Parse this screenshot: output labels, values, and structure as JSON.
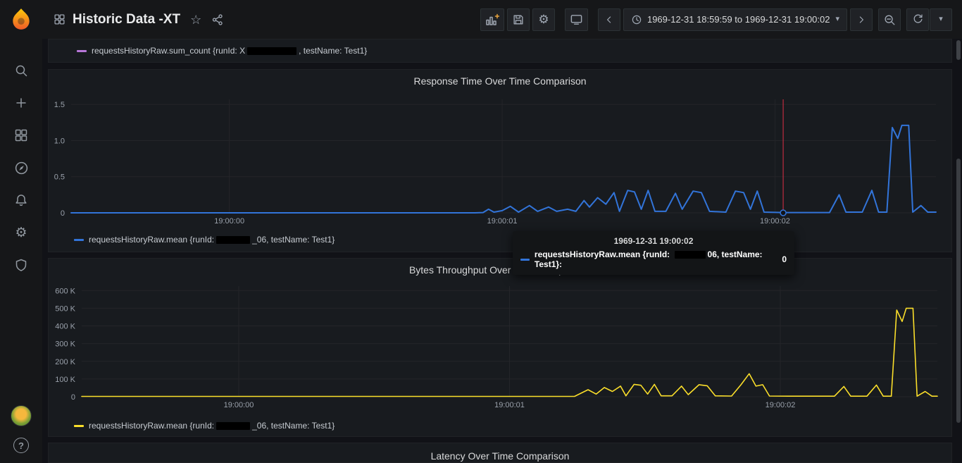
{
  "colors": {
    "blue": "#3274d9",
    "yellow": "#fade2a",
    "purple": "#b877d9",
    "red": "#e02f44"
  },
  "icons": {
    "star": "☆",
    "gear": "⚙",
    "caret_down": "▾",
    "help": "?"
  },
  "nav": {
    "title": "Historic Data -XT",
    "time_range": "1969-12-31 18:59:59 to 1969-12-31 19:00:02"
  },
  "top_panel": {
    "legend_color": "#b877d9",
    "legend_pre": "requestsHistoryRaw.sum_count {runId: X",
    "legend_post": ", testName: Test1}"
  },
  "tooltip": {
    "timestamp": "1969-12-31 19:00:02",
    "series_color": "#3274d9",
    "label_pre": "requestsHistoryRaw.mean {runId: ",
    "label_post": "06, testName: Test1}:",
    "value": "0"
  },
  "latency_panel": {
    "title": "Latency Over Time Comparison"
  },
  "chart_data": [
    {
      "type": "line",
      "title": "Response Time Over Time Comparison",
      "series_label_pre": "requestsHistoryRaw.mean {runId: ",
      "series_label_post": "_06, testName: Test1}",
      "color": "#3274d9",
      "line_width": 2,
      "x_ticks": [
        {
          "value": 0,
          "label": "19:00:00"
        },
        {
          "value": 1,
          "label": "19:00:01"
        },
        {
          "value": 2,
          "label": "19:00:02"
        }
      ],
      "y_ticks": [
        {
          "value": 0,
          "label": "0"
        },
        {
          "value": 0.5,
          "label": "0.5"
        },
        {
          "value": 1.0,
          "label": "1.0"
        },
        {
          "value": 1.5,
          "label": "1.5"
        }
      ],
      "x_range": [
        -0.58,
        2.59
      ],
      "y_range": [
        0,
        1.57
      ],
      "annotation_x": 2.03,
      "annotation_color": "#e02f44",
      "hover_point": [
        2.03,
        0
      ],
      "points": [
        [
          -0.58,
          0
        ],
        [
          0.3,
          0
        ],
        [
          0.6,
          0
        ],
        [
          0.9,
          0
        ],
        [
          0.93,
          0.004
        ],
        [
          0.95,
          0.05
        ],
        [
          0.97,
          0.01
        ],
        [
          1.0,
          0.03
        ],
        [
          1.03,
          0.09
        ],
        [
          1.06,
          0.01
        ],
        [
          1.1,
          0.1
        ],
        [
          1.13,
          0.02
        ],
        [
          1.17,
          0.08
        ],
        [
          1.2,
          0.02
        ],
        [
          1.24,
          0.05
        ],
        [
          1.27,
          0.02
        ],
        [
          1.3,
          0.17
        ],
        [
          1.32,
          0.08
        ],
        [
          1.35,
          0.21
        ],
        [
          1.38,
          0.12
        ],
        [
          1.41,
          0.28
        ],
        [
          1.43,
          0.02
        ],
        [
          1.46,
          0.31
        ],
        [
          1.485,
          0.29
        ],
        [
          1.51,
          0.05
        ],
        [
          1.535,
          0.31
        ],
        [
          1.56,
          0.02
        ],
        [
          1.6,
          0.02
        ],
        [
          1.635,
          0.27
        ],
        [
          1.66,
          0.05
        ],
        [
          1.7,
          0.3
        ],
        [
          1.73,
          0.28
        ],
        [
          1.76,
          0.02
        ],
        [
          1.82,
          0.01
        ],
        [
          1.855,
          0.3
        ],
        [
          1.885,
          0.28
        ],
        [
          1.91,
          0.05
        ],
        [
          1.935,
          0.3
        ],
        [
          1.96,
          0.01
        ],
        [
          2.03,
          0.004
        ],
        [
          2.12,
          0.004
        ],
        [
          2.2,
          0.004
        ],
        [
          2.235,
          0.25
        ],
        [
          2.26,
          0.01
        ],
        [
          2.32,
          0.01
        ],
        [
          2.355,
          0.31
        ],
        [
          2.38,
          0.01
        ],
        [
          2.41,
          0.01
        ],
        [
          2.43,
          1.18
        ],
        [
          2.45,
          1.03
        ],
        [
          2.465,
          1.21
        ],
        [
          2.49,
          1.21
        ],
        [
          2.505,
          0.01
        ],
        [
          2.535,
          0.1
        ],
        [
          2.56,
          0.01
        ],
        [
          2.59,
          0.01
        ]
      ]
    },
    {
      "type": "line",
      "title": "Bytes Throughput Over Time Comparison",
      "series_label_pre": "requestsHistoryRaw.mean {runId: ",
      "series_label_post": "_06, testName: Test1}",
      "color": "#fade2a",
      "line_width": 1.6,
      "x_ticks": [
        {
          "value": 0,
          "label": "19:00:00"
        },
        {
          "value": 1,
          "label": "19:00:01"
        },
        {
          "value": 2,
          "label": "19:00:02"
        }
      ],
      "y_ticks": [
        {
          "value": 0,
          "label": "0"
        },
        {
          "value": 100000,
          "label": "100 K"
        },
        {
          "value": 200000,
          "label": "200 K"
        },
        {
          "value": 300000,
          "label": "300 K"
        },
        {
          "value": 400000,
          "label": "400 K"
        },
        {
          "value": 500000,
          "label": "500 K"
        },
        {
          "value": 600000,
          "label": "600 K"
        }
      ],
      "x_range": [
        -0.58,
        2.58
      ],
      "y_range": [
        0,
        625000
      ],
      "annotation_x": null,
      "annotation_color": null,
      "hover_point": null,
      "points": [
        [
          -0.58,
          2000
        ],
        [
          0.5,
          2000
        ],
        [
          1.0,
          2000
        ],
        [
          1.24,
          2000
        ],
        [
          1.29,
          40000
        ],
        [
          1.32,
          15000
        ],
        [
          1.35,
          52000
        ],
        [
          1.38,
          30000
        ],
        [
          1.41,
          60000
        ],
        [
          1.43,
          5000
        ],
        [
          1.46,
          70000
        ],
        [
          1.485,
          65000
        ],
        [
          1.51,
          15000
        ],
        [
          1.535,
          70000
        ],
        [
          1.56,
          5000
        ],
        [
          1.6,
          5000
        ],
        [
          1.635,
          60000
        ],
        [
          1.66,
          12000
        ],
        [
          1.7,
          68000
        ],
        [
          1.73,
          62000
        ],
        [
          1.76,
          5000
        ],
        [
          1.82,
          4000
        ],
        [
          1.855,
          68000
        ],
        [
          1.885,
          130000
        ],
        [
          1.91,
          60000
        ],
        [
          1.935,
          68000
        ],
        [
          1.96,
          4000
        ],
        [
          2.03,
          3000
        ],
        [
          2.12,
          3000
        ],
        [
          2.2,
          3000
        ],
        [
          2.235,
          58000
        ],
        [
          2.26,
          3000
        ],
        [
          2.32,
          3000
        ],
        [
          2.355,
          66000
        ],
        [
          2.38,
          3000
        ],
        [
          2.41,
          3000
        ],
        [
          2.43,
          490000
        ],
        [
          2.45,
          425000
        ],
        [
          2.465,
          500000
        ],
        [
          2.49,
          500000
        ],
        [
          2.505,
          3000
        ],
        [
          2.535,
          30000
        ],
        [
          2.56,
          3000
        ],
        [
          2.58,
          3000
        ]
      ]
    }
  ]
}
